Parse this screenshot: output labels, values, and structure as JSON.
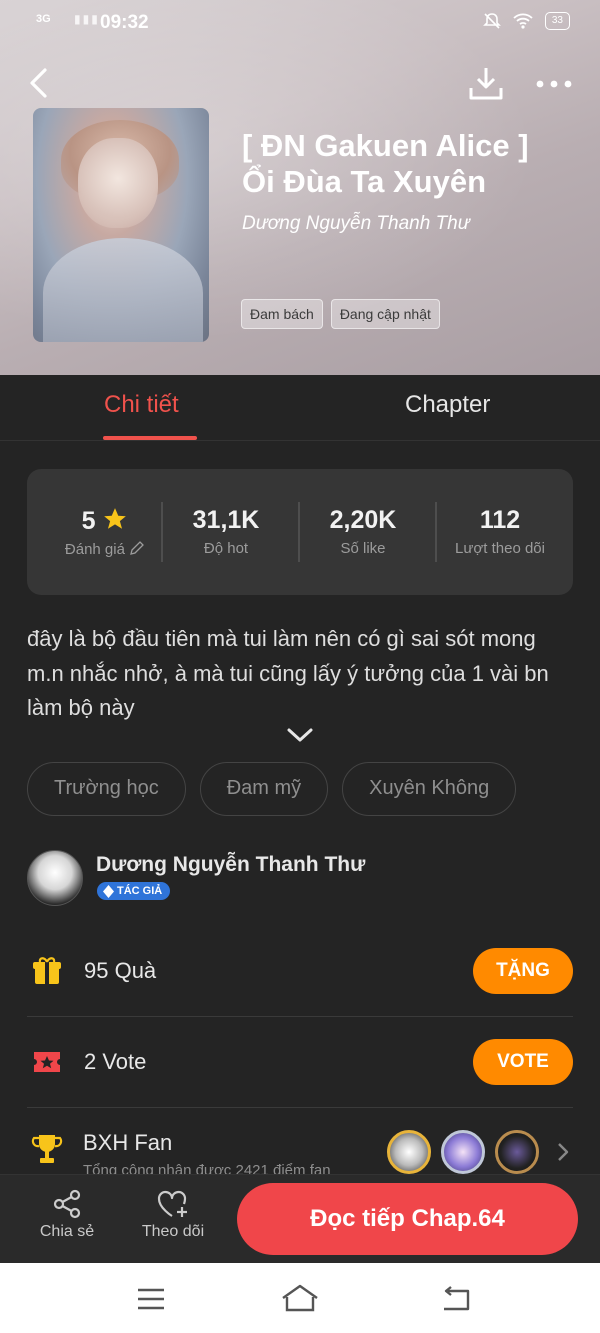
{
  "status": {
    "signal": "3G",
    "time": "09:32",
    "battery": "33"
  },
  "book": {
    "title_line1": "[ ĐN Gakuen Alice ]",
    "title_line2": "Ổi Đùa Ta Xuyên",
    "author": "Dương Nguyễn Thanh Thư",
    "tags": [
      "Đam bách",
      "Đang cập nhật"
    ]
  },
  "tabs": {
    "details": "Chi tiết",
    "chapter": "Chapter"
  },
  "stats": {
    "rating": {
      "value": "5",
      "label": "Đánh giá"
    },
    "hot": {
      "value": "31,1K",
      "label": "Độ hot"
    },
    "likes": {
      "value": "2,20K",
      "label": "Số like"
    },
    "follows": {
      "value": "112",
      "label": "Lượt theo dõi"
    }
  },
  "description": "đây là bộ đầu tiên mà tui làm nên có gì sai sót mong m.n nhắc nhở, à mà tui cũng lấy ý tưởng của 1 vài bn làm bộ này",
  "genres": [
    "Trường học",
    "Đam mỹ",
    "Xuyên Không"
  ],
  "author_card": {
    "name": "Dương Nguyễn Thanh Thư",
    "badge": "TÁC GIẢ"
  },
  "gifts": {
    "text": "95  Quà",
    "button": "TẶNG"
  },
  "votes": {
    "text": "2  Vote",
    "button": "VOTE"
  },
  "fan": {
    "title": "BXH Fan",
    "subtitle": "Tổng cộng nhận được 2421 điểm fan"
  },
  "bottom": {
    "share": "Chia sẻ",
    "follow": "Theo dõi",
    "read": "Đọc tiếp Chap.64"
  },
  "colors": {
    "accent": "#f0524c",
    "orange": "#ff8a00",
    "read_button": "#f0464a",
    "background": "#242424"
  }
}
